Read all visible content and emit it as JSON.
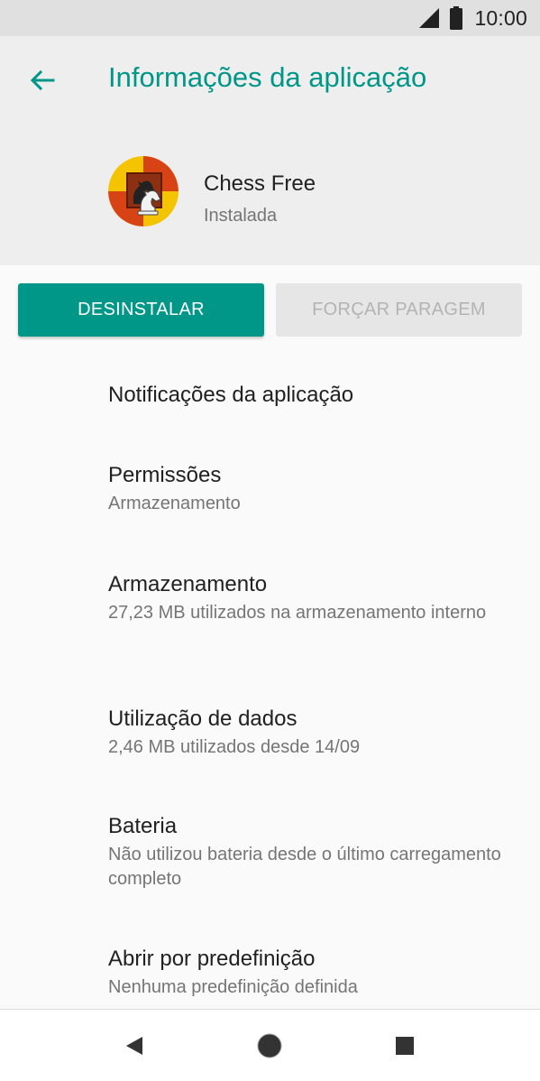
{
  "status_bar": {
    "time": "10:00",
    "icons": [
      "signal-icon",
      "battery-icon"
    ]
  },
  "header": {
    "title": "Informações da aplicação",
    "back_icon": "arrow-back-icon"
  },
  "app": {
    "name": "Chess Free",
    "status": "Instalada",
    "icon": "chess-knight-icon"
  },
  "buttons": {
    "uninstall": "DESINSTALAR",
    "force_stop": "FORÇAR PARAGEM"
  },
  "settings": [
    {
      "title": "Notificações da aplicação",
      "summary": ""
    },
    {
      "title": "Permissões",
      "summary": "Armazenamento"
    },
    {
      "title": "Armazenamento",
      "summary": "27,23 MB utilizados na armazenamento interno"
    },
    {
      "title": "Utilização de dados",
      "summary": "2,46 MB utilizados desde 14/09"
    },
    {
      "title": "Bateria",
      "summary": "Não utilizou bateria desde o último carregamento completo"
    },
    {
      "title": "Abrir por predefinição",
      "summary": "Nenhuma predefinição definida"
    }
  ],
  "nav_bar": {
    "icons": [
      "back-triangle-icon",
      "home-circle-icon",
      "recents-square-icon"
    ]
  },
  "colors": {
    "accent": "#009688",
    "status_bar": "#e0e0e0",
    "header_bg": "#eeeeee",
    "page_bg": "#fafafa",
    "disabled_button_bg": "#e6e6e6",
    "disabled_button_text": "#b3b3b3"
  }
}
